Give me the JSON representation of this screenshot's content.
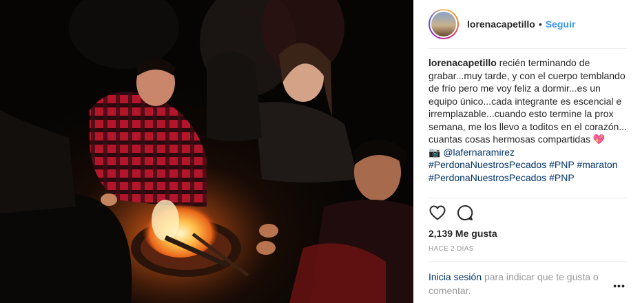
{
  "post": {
    "username": "lorenacapetillo",
    "follow_label": "Seguir",
    "separator": "•",
    "caption": {
      "username": "lorenacapetillo",
      "text": "recién terminando de grabar...muy tarde, y con el cuerpo temblando de frío pero me voy feliz a dormir...es un equipo único...cada integrante es escencial e irremplazable...cuando esto termine la prox semana, me los llevo a toditos en el corazón...",
      "line2": "cuantas cosas hermosas compartidas",
      "heart_emoji": "💖",
      "camera_emoji": "📷",
      "mention": "@lafernaramirez",
      "hashtags": "#PerdonaNuestrosPecados #PNP #maraton",
      "hashtags_cut": "#PerdonaNuestrosPecados #PNP"
    },
    "likes": "2,139 Me gusta",
    "time_ago": "HACE 2 DÍAS",
    "login_link": "Inicia sesión",
    "login_text": "para indicar que te gusta o comentar.",
    "more_label": "•••"
  },
  "icons": {
    "like": "heart-outline-icon",
    "comment": "comment-bubble-icon",
    "more": "more-options-icon"
  },
  "colors": {
    "link_blue": "#3897f0",
    "text": "#262626",
    "muted": "#999999",
    "divider": "#efefef",
    "dark_link": "#003569"
  }
}
